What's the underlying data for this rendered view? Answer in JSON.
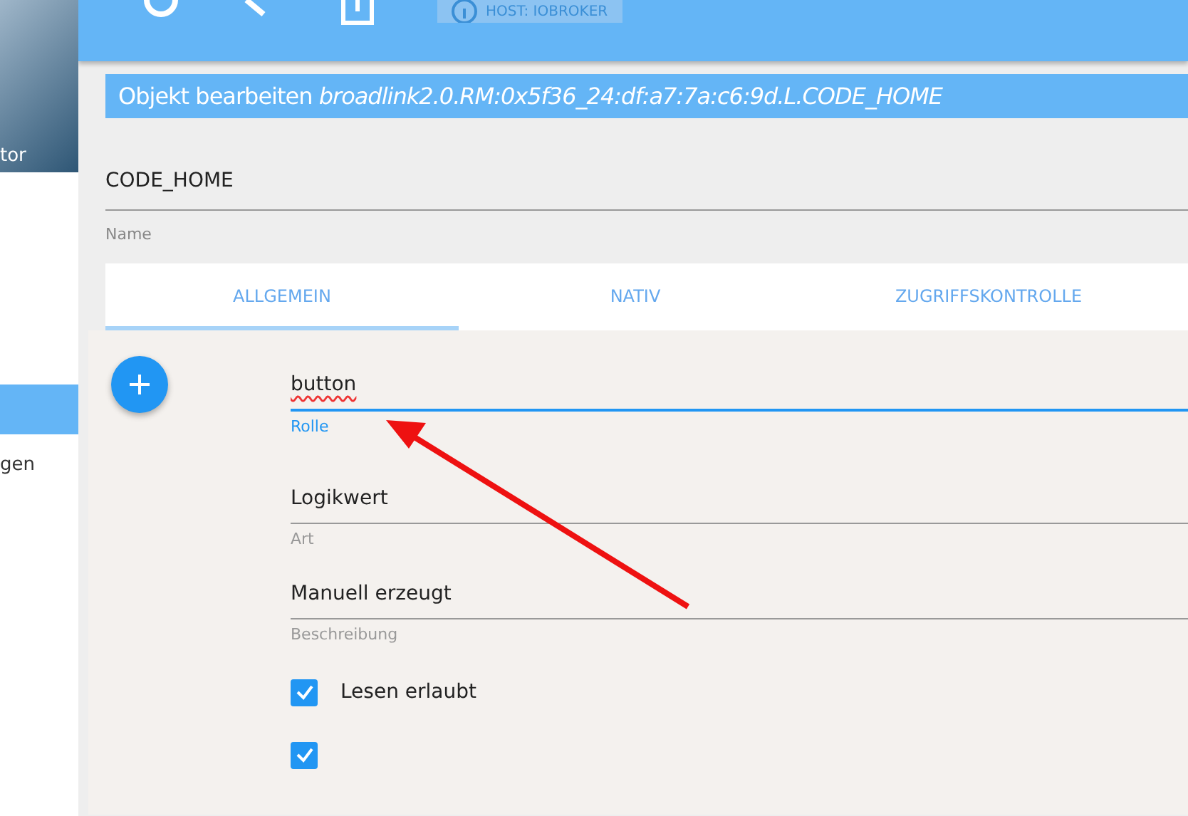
{
  "sidebar": {
    "photo_caption": "tor",
    "items": [
      {
        "selected": true
      },
      {
        "label": "gen",
        "selected": false
      }
    ]
  },
  "toolbar": {
    "host_button": {
      "label": "HOST: IOBROKER",
      "disabled": true
    }
  },
  "dialog": {
    "title": "Objekt bearbeiten",
    "object_id": "broadlink2.0.RM:0x5f36_24:df:a7:7a:c6:9d.L.CODE_HOME",
    "name_field": {
      "value": "CODE_HOME",
      "label": "Name"
    },
    "tabs": [
      {
        "label": "ALLGEMEIN",
        "selected": true
      },
      {
        "label": "NATIV",
        "selected": false
      },
      {
        "label": "ZUGRIFFSKONTROLLE",
        "selected": false
      }
    ],
    "fields": [
      {
        "value": "button",
        "label": "Rolle",
        "focused": true
      },
      {
        "value": "Logikwert",
        "label": "Art",
        "focused": false
      },
      {
        "value": "Manuell erzeugt",
        "label": "Beschreibung",
        "focused": false
      }
    ],
    "checkboxes": [
      {
        "label": "Lesen erlaubt",
        "checked": true
      },
      {
        "checked": true
      }
    ]
  }
}
